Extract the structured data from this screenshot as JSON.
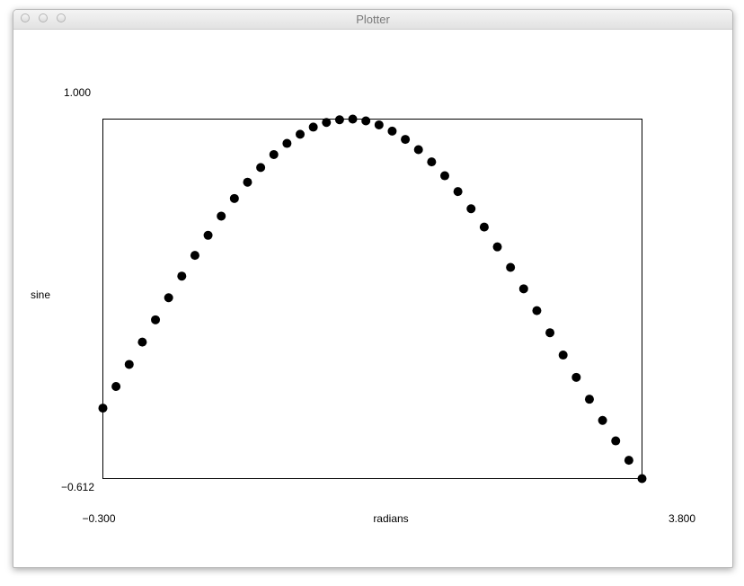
{
  "window": {
    "title": "Plotter"
  },
  "chart_data": {
    "type": "scatter",
    "xlabel": "radians",
    "ylabel": "sine",
    "xlim": [
      -0.3,
      3.8
    ],
    "ylim": [
      -0.612,
      1.0
    ],
    "x_min_label": "−0.300",
    "x_max_label": "3.800",
    "y_max_label": "1.000",
    "y_min_label": "−0.612",
    "grid": false,
    "marker_color": "#000000",
    "x": [
      -0.3,
      -0.2,
      -0.1,
      0.0,
      0.1,
      0.2,
      0.3,
      0.4,
      0.5,
      0.6,
      0.7,
      0.8,
      0.9,
      1.0,
      1.1,
      1.2,
      1.3,
      1.4,
      1.5,
      1.6,
      1.7,
      1.8,
      1.9,
      2.0,
      2.1,
      2.2,
      2.3,
      2.4,
      2.5,
      2.6,
      2.7,
      2.8,
      2.9,
      3.0,
      3.1,
      3.2,
      3.3,
      3.4,
      3.5,
      3.6,
      3.7,
      3.8
    ],
    "y": [
      -0.296,
      -0.199,
      -0.1,
      0.0,
      0.1,
      0.199,
      0.296,
      0.389,
      0.479,
      0.565,
      0.644,
      0.717,
      0.783,
      0.841,
      0.891,
      0.932,
      0.964,
      0.985,
      0.997,
      1.0,
      0.992,
      0.974,
      0.946,
      0.909,
      0.863,
      0.808,
      0.746,
      0.675,
      0.598,
      0.516,
      0.427,
      0.335,
      0.239,
      0.141,
      0.042,
      -0.058,
      -0.158,
      -0.256,
      -0.351,
      -0.443,
      -0.53,
      -0.612
    ]
  }
}
